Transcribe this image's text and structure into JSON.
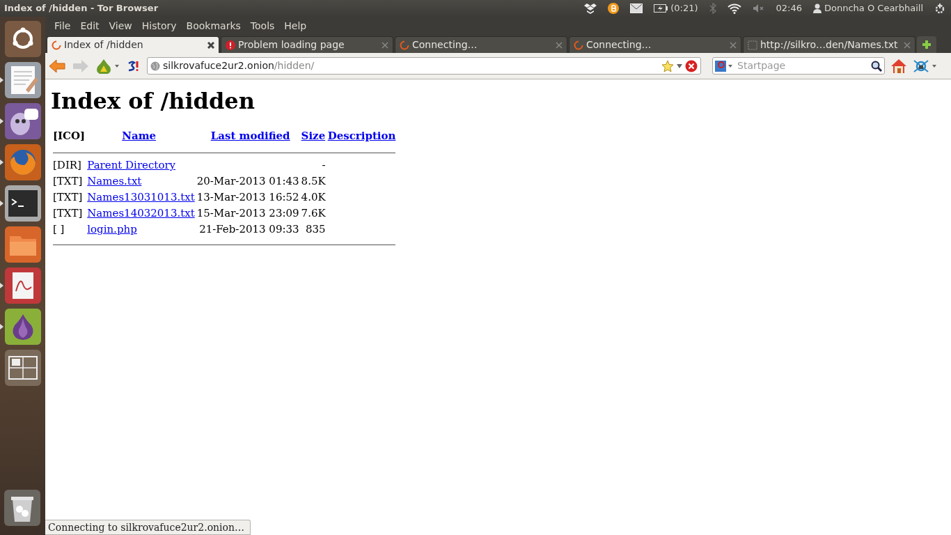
{
  "window": {
    "title": "Index of /hidden - Tor Browser"
  },
  "indicators": {
    "battery_time": "(0:21)",
    "clock": "02:46",
    "user": "Donncha O Cearbhaill"
  },
  "launcher": [
    {
      "kind": "dash",
      "running": false
    },
    {
      "kind": "editor",
      "running": true
    },
    {
      "kind": "chat",
      "running": true
    },
    {
      "kind": "firefox",
      "running": true
    },
    {
      "kind": "terminal",
      "running": true
    },
    {
      "kind": "files",
      "running": false
    },
    {
      "kind": "reader",
      "running": true
    },
    {
      "kind": "tor",
      "running": true
    },
    {
      "kind": "workspaces",
      "running": false
    },
    {
      "kind": "trash",
      "running": false
    }
  ],
  "menu": [
    "File",
    "Edit",
    "View",
    "History",
    "Bookmarks",
    "Tools",
    "Help"
  ],
  "tabs": [
    {
      "label": "Index of /hidden",
      "kind": "loading",
      "selected": true
    },
    {
      "label": "Problem loading page",
      "kind": "error",
      "selected": false
    },
    {
      "label": "Connecting…",
      "kind": "loading",
      "selected": false
    },
    {
      "label": "Connecting…",
      "kind": "loading",
      "selected": false
    },
    {
      "label": "http://silkro…den/Names.txt",
      "kind": "blank",
      "selected": false
    }
  ],
  "address": {
    "host": "silkrovafuce2ur2.onion",
    "path": "/hidden/"
  },
  "search": {
    "placeholder": "Startpage"
  },
  "page": {
    "heading": "Index of /hidden",
    "columns": [
      "[ICO]",
      "Name",
      "Last modified",
      "Size",
      "Description"
    ],
    "rows": [
      {
        "icon": "[DIR]",
        "name": "Parent Directory",
        "modified": "",
        "size": "-"
      },
      {
        "icon": "[TXT]",
        "name": "Names.txt",
        "modified": "20-Mar-2013 01:43",
        "size": "8.5K"
      },
      {
        "icon": "[TXT]",
        "name": "Names13031013.txt",
        "modified": "13-Mar-2013 16:52",
        "size": "4.0K"
      },
      {
        "icon": "[TXT]",
        "name": "Names14032013.txt",
        "modified": "15-Mar-2013 23:09",
        "size": "7.6K"
      },
      {
        "icon": "[ ]",
        "name": "login.php",
        "modified": "21-Feb-2013 09:33",
        "size": "835"
      }
    ]
  },
  "status_bar": "Connecting to silkrovafuce2ur2.onion…"
}
